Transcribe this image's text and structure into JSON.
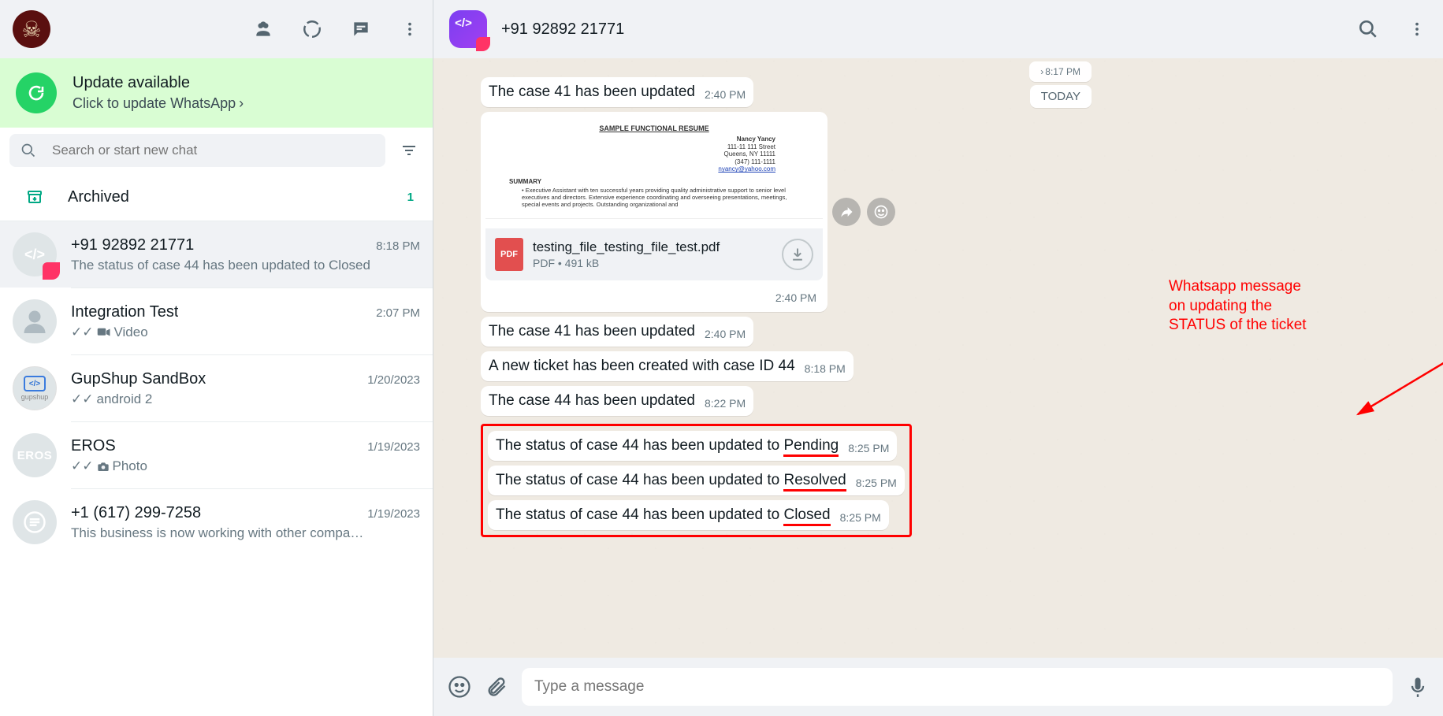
{
  "left_header": {},
  "update": {
    "title": "Update available",
    "subtitle": "Click to update WhatsApp"
  },
  "search": {
    "placeholder": "Search or start new chat"
  },
  "archived": {
    "label": "Archived",
    "count": "1"
  },
  "chats": [
    {
      "name": "+91 92892 21771",
      "time": "8:18 PM",
      "preview": "The status of case 44 has been updated to Closed"
    },
    {
      "name": "Integration Test",
      "time": "2:07 PM",
      "preview": "Video"
    },
    {
      "name": "GupShup SandBox",
      "time": "1/20/2023",
      "preview": "android 2"
    },
    {
      "name": "EROS",
      "time": "1/19/2023",
      "preview": "Photo"
    },
    {
      "name": "+1 (617) 299-7258",
      "time": "1/19/2023",
      "preview": "This business is now working with other compa…"
    }
  ],
  "conversation": {
    "contact_name": "+91 92892 21771",
    "prev_time_chip": "8:17 PM",
    "day_label": "TODAY",
    "messages": [
      {
        "text": "The case 41 has been updated",
        "time": "2:40 PM"
      }
    ],
    "file": {
      "name": "testing_file_testing_file_test.pdf",
      "meta": "PDF • 491 kB",
      "time": "2:40 PM",
      "preview": {
        "title": "SAMPLE FUNCTIONAL RESUME",
        "addr_name": "Nancy Yancy",
        "addr_line1": "111-11 111 Street",
        "addr_line2": "Queens, NY 11111",
        "addr_phone": "(347) 111-1111",
        "addr_email": "nyancy@yahoo.com",
        "summary_label": "SUMMARY",
        "summary_text": "Executive Assistant with ten successful years providing quality administrative support to senior level executives and directors. Extensive experience coordinating and overseeing presentations, meetings, special events and projects. Outstanding organizational and"
      }
    },
    "messages2": [
      {
        "text": "The case 41 has been updated",
        "time": "2:40 PM"
      },
      {
        "text": "A new ticket has been created with case ID 44",
        "time": "8:18 PM"
      },
      {
        "text": "The case 44 has been updated",
        "time": "8:22 PM"
      }
    ],
    "highlighted": [
      {
        "prefix": "The status of case 44 has been updated to ",
        "word": "Pending",
        "time": "8:25 PM"
      },
      {
        "prefix": "The status of case 44 has been updated to ",
        "word": "Resolved",
        "time": "8:25 PM"
      },
      {
        "prefix": "The status of case 44 has been updated to ",
        "word": "Closed",
        "time": "8:25 PM"
      }
    ]
  },
  "annotation": {
    "line1": "Whatsapp message",
    "line2": "on updating the",
    "line3": "STATUS of the ticket"
  },
  "composer": {
    "placeholder": "Type a message"
  }
}
